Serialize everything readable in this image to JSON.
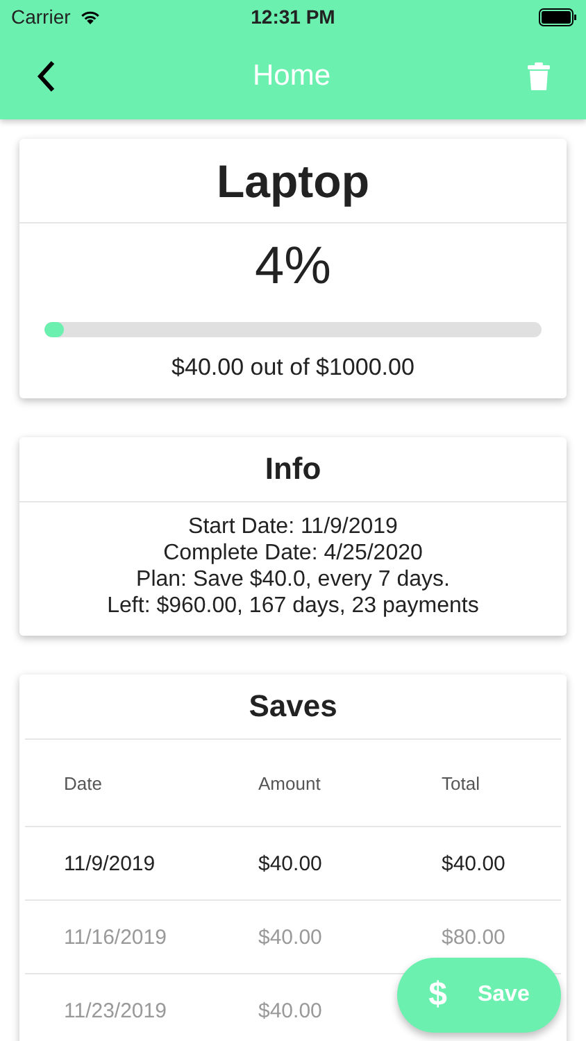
{
  "status_bar": {
    "carrier": "Carrier",
    "time": "12:31 PM"
  },
  "header": {
    "title": "Home"
  },
  "goal": {
    "name": "Laptop",
    "percent": "4%",
    "level": 0.04,
    "summary": "$40.00 out of $1000.00"
  },
  "info": {
    "title": "Info",
    "lines": [
      "Start Date: 11/9/2019",
      "Complete Date: 4/25/2020",
      "Plan: Save $40.0, every 7 days.",
      "Left: $960.00, 167 days, 23 payments"
    ]
  },
  "saves": {
    "title": "Saves",
    "columns": [
      "Date",
      "Amount",
      "Total"
    ],
    "rows": [
      {
        "cells": [
          "11/9/2019",
          "$40.00",
          "$40.00"
        ],
        "done": true
      },
      {
        "cells": [
          "11/16/2019",
          "$40.00",
          "$80.00"
        ],
        "done": false
      },
      {
        "cells": [
          "11/23/2019",
          "$40.00"
        ],
        "done": false
      }
    ]
  },
  "save_button": {
    "icon": "$",
    "label": "Save"
  }
}
